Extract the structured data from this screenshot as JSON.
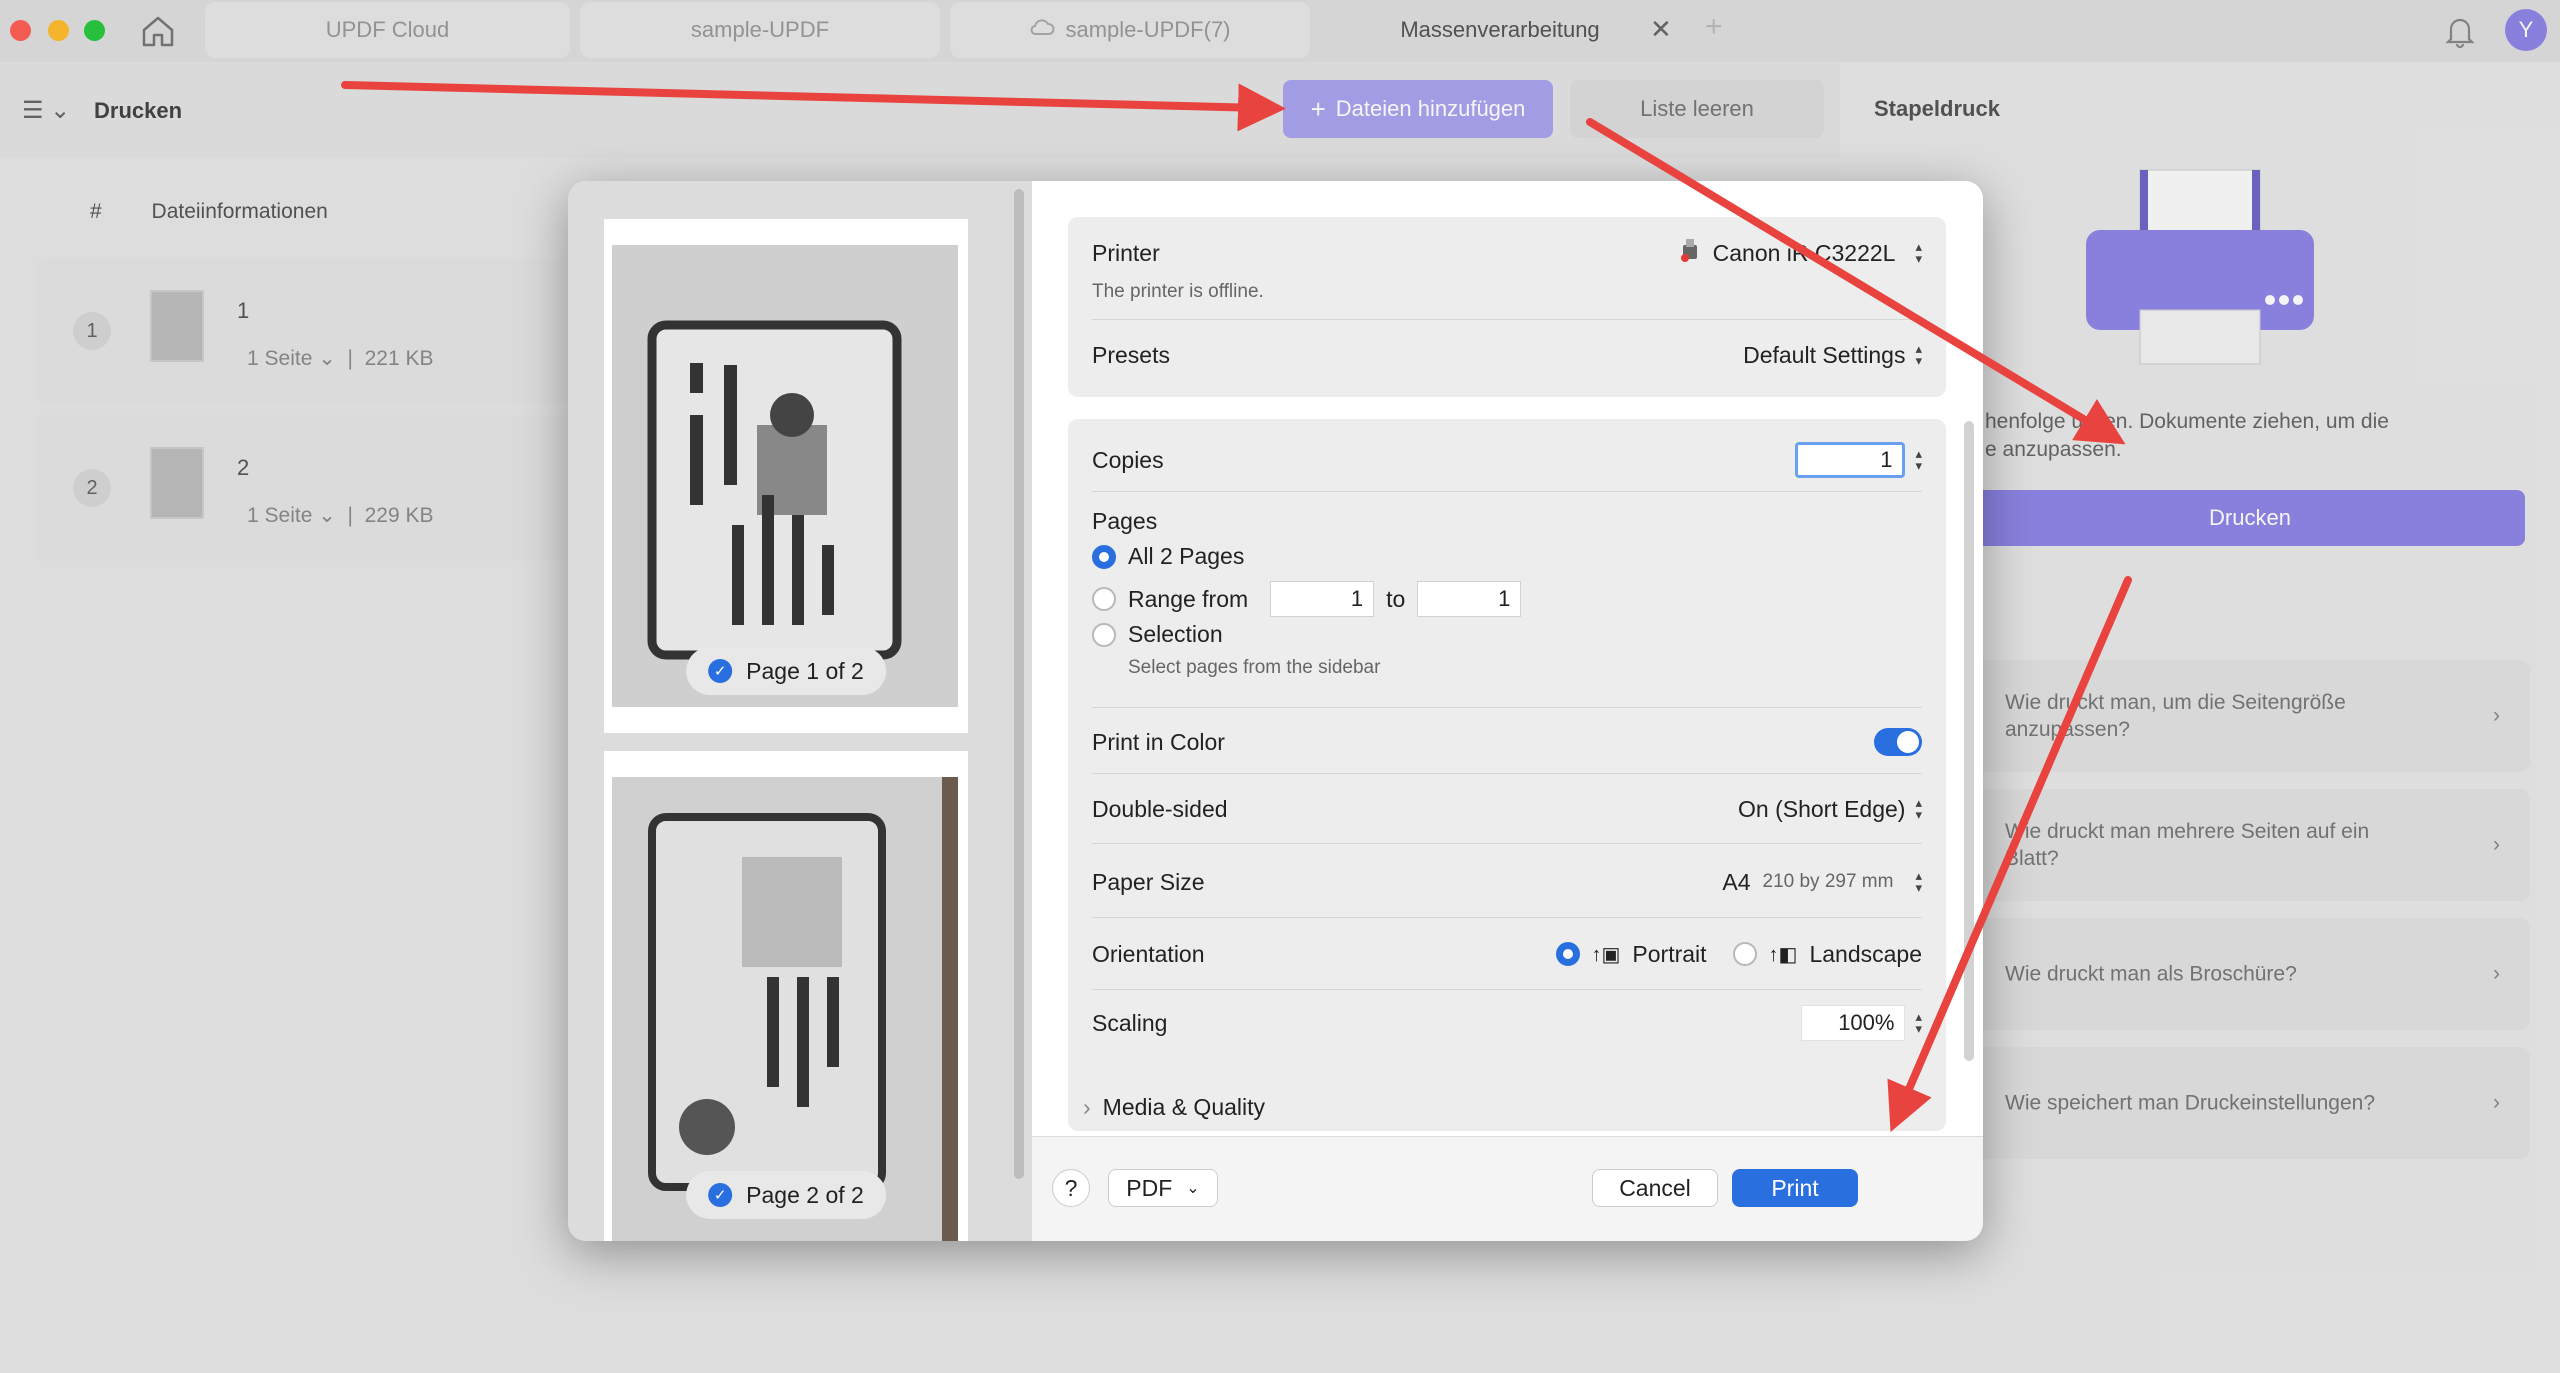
{
  "tabs": [
    {
      "label": "UPDF Cloud"
    },
    {
      "label": "sample-UPDF"
    },
    {
      "label": "sample-UPDF(7)"
    },
    {
      "label": "Massenverarbeitung"
    }
  ],
  "avatar_initial": "Y",
  "toolbar": {
    "title": "Drucken",
    "add_files": "Dateien hinzufügen",
    "clear_list": "Liste leeren"
  },
  "list": {
    "col_num": "#",
    "col_info": "Dateiinformationen",
    "files": [
      {
        "num": "1",
        "name": "1",
        "pages": "1 Seite",
        "size": "221 KB"
      },
      {
        "num": "2",
        "name": "2",
        "pages": "1 Seite",
        "size": "229 KB"
      }
    ]
  },
  "right": {
    "title": "Stapeldruck",
    "hint_line1": "henfolge    ucken. Dokumente ziehen, um die",
    "hint_line2": "e anzupassen.",
    "print_button": "Drucken",
    "faqs": [
      {
        "q": "Wie druckt man, um die Seitengröße anzupassen?"
      },
      {
        "q": "Wie druckt man mehrere Seiten auf ein Blatt?"
      },
      {
        "q": "Wie druckt man als Broschüre?"
      },
      {
        "q": "Wie speichert man Druckeinstellungen?"
      }
    ]
  },
  "dialog": {
    "preview": [
      {
        "label": "Page 1 of 2"
      },
      {
        "label": "Page 2 of 2"
      }
    ],
    "printer_label": "Printer",
    "printer_value": "Canon iR C3222L",
    "printer_status": "The printer is offline.",
    "presets_label": "Presets",
    "presets_value": "Default Settings",
    "copies_label": "Copies",
    "copies_value": "1",
    "pages_label": "Pages",
    "pages_all": "All 2 Pages",
    "pages_range": "Range from",
    "range_from": "1",
    "range_to_label": "to",
    "range_to": "1",
    "pages_selection": "Selection",
    "pages_selection_hint": "Select pages from the sidebar",
    "color_label": "Print in Color",
    "duplex_label": "Double-sided",
    "duplex_value": "On (Short Edge)",
    "paper_label": "Paper Size",
    "paper_value": "A4",
    "paper_dims": "210 by 297 mm",
    "orientation_label": "Orientation",
    "portrait": "Portrait",
    "landscape": "Landscape",
    "scaling_label": "Scaling",
    "scaling_value": "100%",
    "media_label": "Media & Quality",
    "help": "?",
    "pdf": "PDF",
    "cancel": "Cancel",
    "print": "Print"
  },
  "colors": {
    "accent": "#2a6fe0",
    "purple": "#8f86e8",
    "arrow": "#e8433e"
  }
}
